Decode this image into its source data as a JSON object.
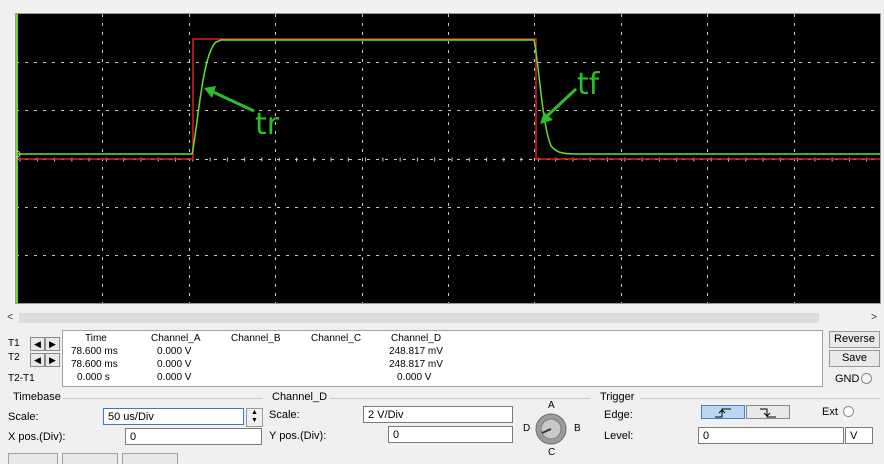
{
  "scope": {
    "annotations": {
      "rise": "tr",
      "fall": "tf"
    },
    "colors": {
      "grid": "#c8c8c8",
      "channel_a": "#d81f1f",
      "channel_d": "#6bdd2a",
      "annotation": "#2bbd2b",
      "background": "#000000"
    }
  },
  "measurements": {
    "headers": {
      "time": "Time",
      "ch_a": "Channel_A",
      "ch_b": "Channel_B",
      "ch_c": "Channel_C",
      "ch_d": "Channel_D"
    },
    "rows": [
      {
        "label": "T1",
        "time": "78.600 ms",
        "ch_a": "0.000 V",
        "ch_d": "248.817 mV"
      },
      {
        "label": "T2",
        "time": "78.600 ms",
        "ch_a": "0.000 V",
        "ch_d": "248.817 mV"
      },
      {
        "label": "T2-T1",
        "time": "0.000 s",
        "ch_a": "0.000 V",
        "ch_d": "0.000 V"
      }
    ]
  },
  "buttons": {
    "reverse": "Reverse",
    "save": "Save",
    "gnd": "GND"
  },
  "timebase": {
    "title": "Timebase",
    "scale_label": "Scale:",
    "scale_value": "50 us/Div",
    "xpos_label": "X pos.(Div):",
    "xpos_value": "0"
  },
  "channel": {
    "title": "Channel_D",
    "scale_label": "Scale:",
    "scale_value": "2  V/Div",
    "ypos_label": "Y pos.(Div):",
    "ypos_value": "0",
    "selector": {
      "a": "A",
      "b": "B",
      "c": "C",
      "d": "D"
    }
  },
  "trigger": {
    "title": "Trigger",
    "edge_label": "Edge:",
    "ext_label": "Ext",
    "level_label": "Level:",
    "level_value": "0",
    "level_unit": "V"
  },
  "icons": {
    "left_arrow": "◀",
    "right_arrow": "▶"
  }
}
